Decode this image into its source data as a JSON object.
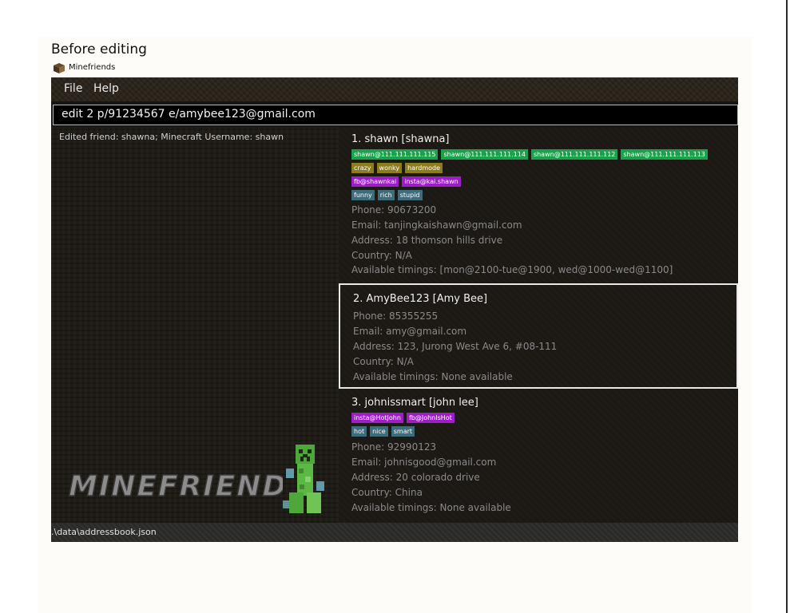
{
  "caption": "Before editing",
  "window": {
    "title": "Minefriends"
  },
  "menu": {
    "file": "File",
    "help": "Help"
  },
  "command": {
    "value": "edit 2 p/91234567 e/amybee123@gmail.com"
  },
  "result": {
    "text": "Edited friend: shawna; Minecraft Username: shawn"
  },
  "logo": {
    "text": "MINEFRIENDS"
  },
  "friends": [
    {
      "title": "1.  shawn [shawna]",
      "servers": [
        "shawn@111.111.111.115",
        "shawn@111.111.111.114",
        "shawn@111.111.111.112",
        "shawn@111.111.111.113"
      ],
      "game_types": [
        "crazy",
        "wonky",
        "hardmode"
      ],
      "socials": [
        "fb@shawnkai",
        "insta@kai.shawn"
      ],
      "tags": [
        "funny",
        "rich",
        "stupid"
      ],
      "phone": "Phone: 90673200",
      "email": "Email: tanjingkaishawn@gmail.com",
      "address": "Address: 18 thomson hills drive",
      "country": "Country: N/A",
      "timings": "Available timings: [mon@2100-tue@1900, wed@1000-wed@1100]"
    },
    {
      "title": "2.  AmyBee123 [Amy Bee]",
      "phone": "Phone: 85355255",
      "email": "Email: amy@gmail.com",
      "address": "Address: 123, Jurong West Ave 6, #08-111",
      "country": "Country: N/A",
      "timings": "Available timings: None available"
    },
    {
      "title": "3.  johnissmart [john lee]",
      "socials": [
        "insta@HotJohn",
        "fb@JohnIsHot"
      ],
      "tags": [
        "hot",
        "nice",
        "smart"
      ],
      "phone": "Phone: 92990123",
      "email": "Email: johnisgood@gmail.com",
      "address": "Address: 20 colorado drive",
      "country": "Country: China",
      "timings": "Available timings: None available"
    }
  ],
  "status": {
    "path": ".\\data\\addressbook.json"
  },
  "colors": {
    "server_tag": "#1aa14b",
    "game_type_tag": "#8b7d1c",
    "social_tag": "#9d1ec7",
    "tag": "#3d6c7a"
  },
  "icons": {
    "app": "minecraft-block-icon",
    "mascot": "creeper-icon"
  }
}
